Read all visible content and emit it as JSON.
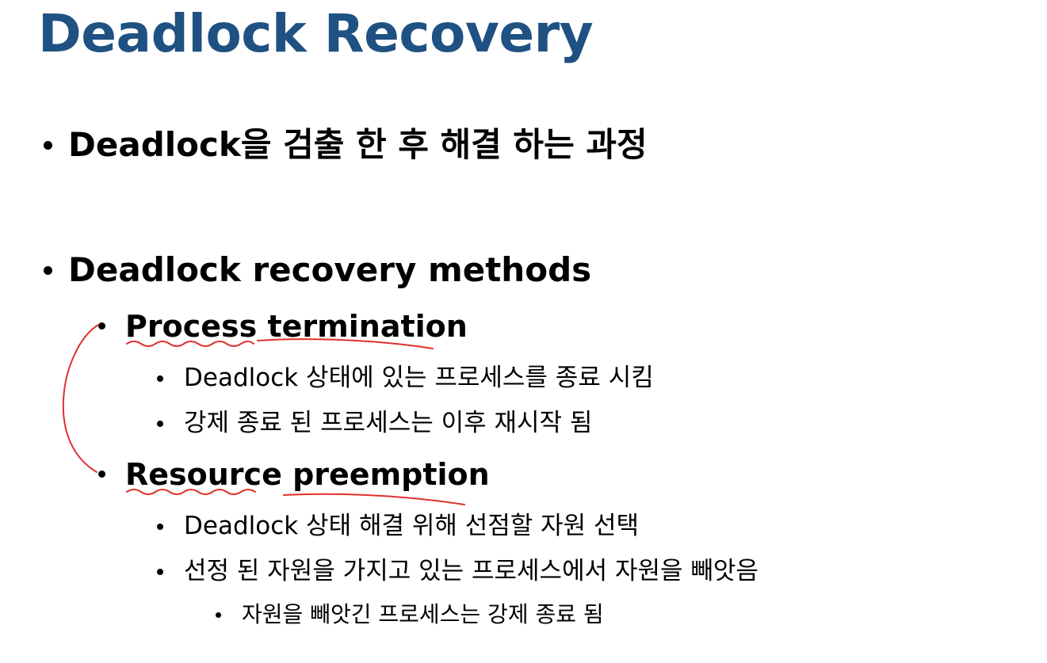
{
  "slide": {
    "title": "Deadlock Recovery",
    "bullets": [
      {
        "text": "Deadlock을 검출 한 후 해결 하는 과정"
      },
      {
        "text": "Deadlock recovery methods"
      }
    ],
    "methods": [
      {
        "label": "Process termination",
        "details": [
          "Deadlock 상태에 있는 프로세스를 종료 시킴",
          "강제 종료 된 프로세스는 이후 재시작 됨"
        ]
      },
      {
        "label": "Resource preemption",
        "details": [
          "Deadlock 상태 해결 위해 선점할 자원 선택",
          "선정 된 자원을 가지고 있는 프로세스에서 자원을 빼앗음"
        ],
        "sub_details": [
          "자원을 빼앗긴 프로세스는 강제 종료 됨"
        ]
      }
    ]
  },
  "colors": {
    "title": "#1f5182",
    "text": "#000000",
    "annotation": "#e0302b"
  }
}
